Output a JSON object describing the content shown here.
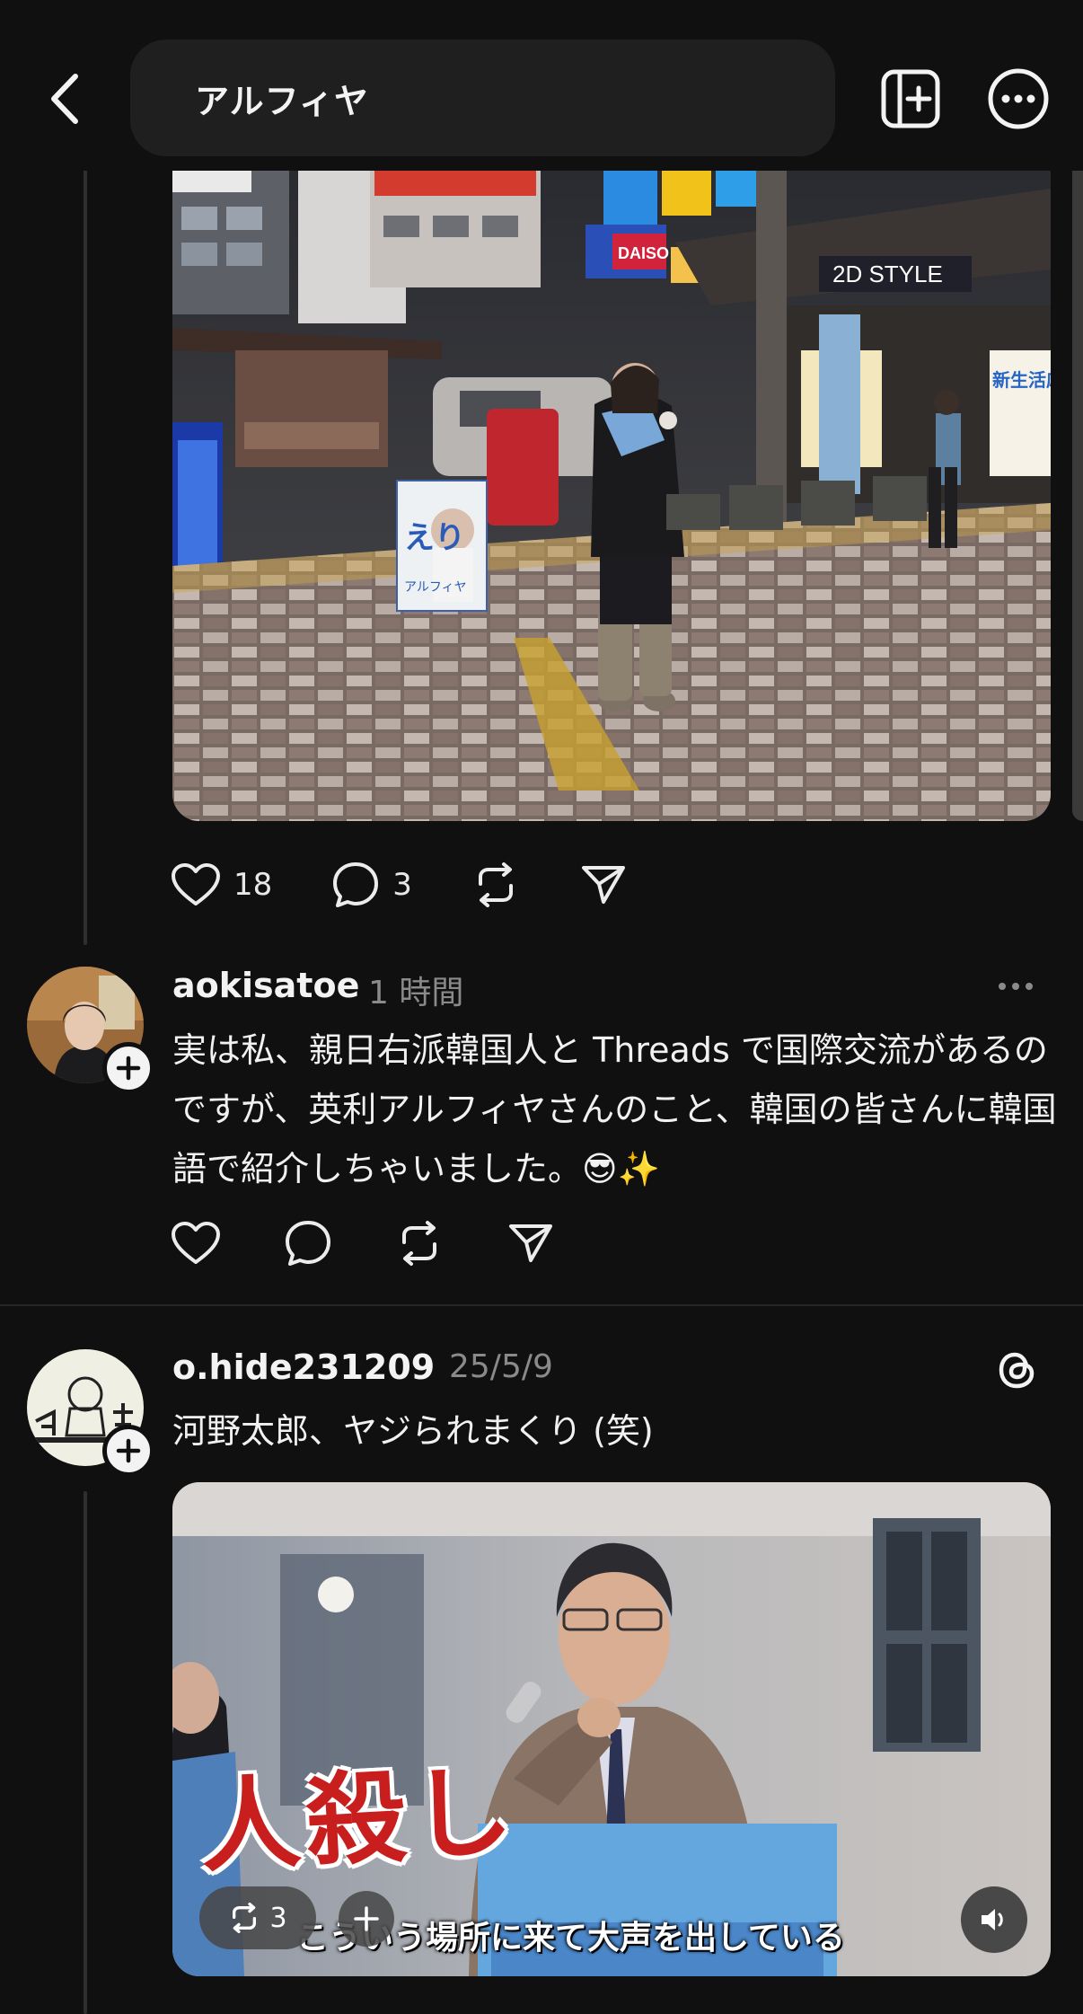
{
  "header": {
    "search_query": "アルフィヤ"
  },
  "post1": {
    "likes": "18",
    "replies": "3"
  },
  "post2": {
    "username": "aokisatoe",
    "time": "1 時間",
    "text": "実は私、親日右派韓国人と Threads で国際交流があるのですが、英利アルフィヤさんのこと、韓国の皆さんに韓国語で紹介しちゃいました。😎✨"
  },
  "post3": {
    "username": "o.hide231209",
    "time": "25/5/9",
    "text": "河野太郎、ヤジられまくり (笑)",
    "video": {
      "overlay_text": "人殺し",
      "subtitle": "こういう場所に来て大声を出している",
      "repost_count": "3"
    }
  },
  "photo1_signs": {
    "poster_name": "えり",
    "poster_sub": "アルフィヤ",
    "daiso": "DAISO",
    "banner": "新生活応援",
    "style": "2D STYLE"
  },
  "icons": {
    "back": "chevron-left-icon",
    "new_tab": "add-square-icon",
    "more": "more-circle-icon",
    "like": "heart-icon",
    "reply": "comment-icon",
    "repost": "repost-icon",
    "share": "send-icon",
    "threads": "threads-logo-icon",
    "mute": "speaker-icon"
  }
}
